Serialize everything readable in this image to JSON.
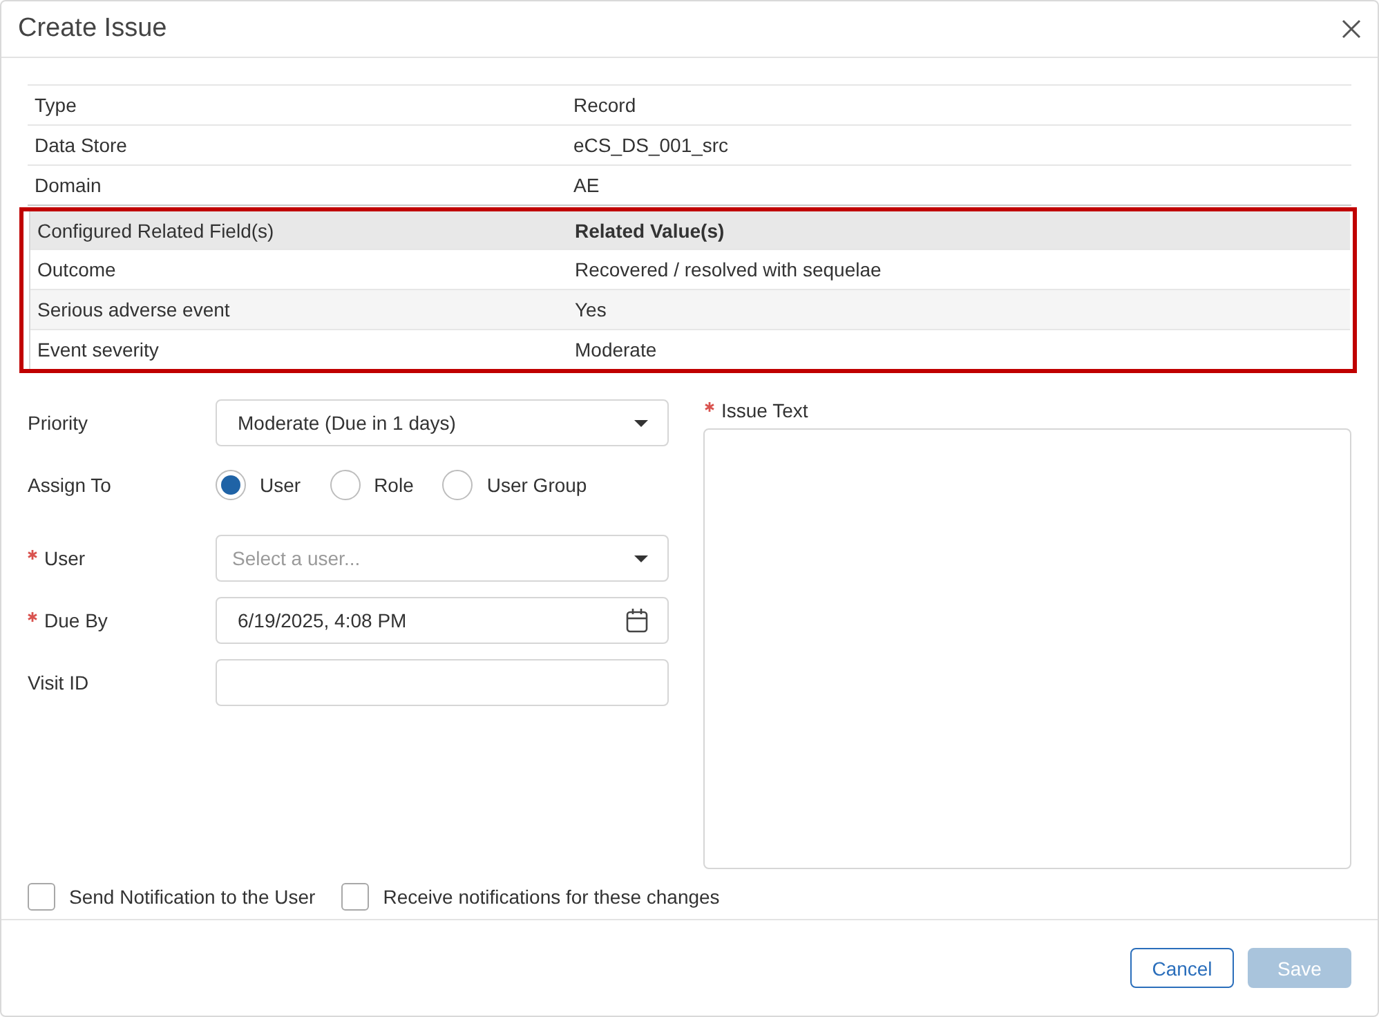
{
  "dialog": {
    "title": "Create Issue"
  },
  "record_details": [
    {
      "label": "Type",
      "value": "Record"
    },
    {
      "label": "Data Store",
      "value": "eCS_DS_001_src"
    },
    {
      "label": "Domain",
      "value": "AE"
    }
  ],
  "related_fields": {
    "highlighted": true,
    "columns": [
      "Configured Related Field(s)",
      "Related Value(s)"
    ],
    "rows": [
      {
        "field": "Outcome",
        "value": "Recovered / resolved with sequelae"
      },
      {
        "field": "Serious adverse event",
        "value": "Yes"
      },
      {
        "field": "Event severity",
        "value": "Moderate"
      }
    ]
  },
  "form": {
    "fields": [
      {
        "kind": "select",
        "label": "Priority",
        "required": false,
        "value": "Moderate (Due in 1 days)"
      },
      {
        "kind": "radio",
        "label": "Assign To",
        "required": false,
        "options": [
          {
            "label": "User",
            "selected": true
          },
          {
            "label": "Role",
            "selected": false
          },
          {
            "label": "User Group",
            "selected": false
          }
        ]
      },
      {
        "kind": "select",
        "label": "User",
        "required": true,
        "placeholder": "Select a user..."
      },
      {
        "kind": "date",
        "label": "Due By",
        "required": true,
        "value": "6/19/2025, 4:08 PM"
      },
      {
        "kind": "text",
        "label": "Visit ID",
        "required": false
      }
    ],
    "issue_text": {
      "label": "Issue Text",
      "required": true
    }
  },
  "notifications": [
    {
      "label": "Send Notification to the User",
      "checked": false
    },
    {
      "label": "Receive notifications for these changes",
      "checked": false
    }
  ],
  "buttons": [
    {
      "kind": "outline",
      "label": "Cancel",
      "disabled": false
    },
    {
      "kind": "filled",
      "label": "Save",
      "disabled": true
    }
  ]
}
